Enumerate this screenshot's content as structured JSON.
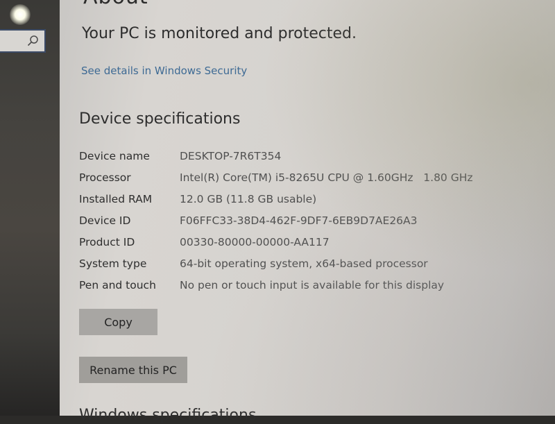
{
  "sidebar": {
    "search": {
      "placeholder": "",
      "icon": "search-icon"
    }
  },
  "page": {
    "title": "About",
    "protection_status": "Your PC is monitored and protected.",
    "security_link": "See details in Windows Security"
  },
  "device_specs": {
    "heading": "Device specifications",
    "rows": [
      {
        "label": "Device name",
        "value": "DESKTOP-7R6T354"
      },
      {
        "label": "Processor",
        "value": "Intel(R) Core(TM) i5-8265U CPU @ 1.60GHz   1.80 GHz"
      },
      {
        "label": "Installed RAM",
        "value": "12.0 GB (11.8 GB usable)"
      },
      {
        "label": "Device ID",
        "value": "F06FFC33-38D4-462F-9DF7-6EB9D7AE26A3"
      },
      {
        "label": "Product ID",
        "value": "00330-80000-00000-AA117"
      },
      {
        "label": "System type",
        "value": "64-bit operating system, x64-based processor"
      },
      {
        "label": "Pen and touch",
        "value": "No pen or touch input is available for this display"
      }
    ],
    "copy_button": "Copy",
    "rename_button": "Rename this PC"
  },
  "next_section": {
    "heading": "Windows specifications"
  }
}
